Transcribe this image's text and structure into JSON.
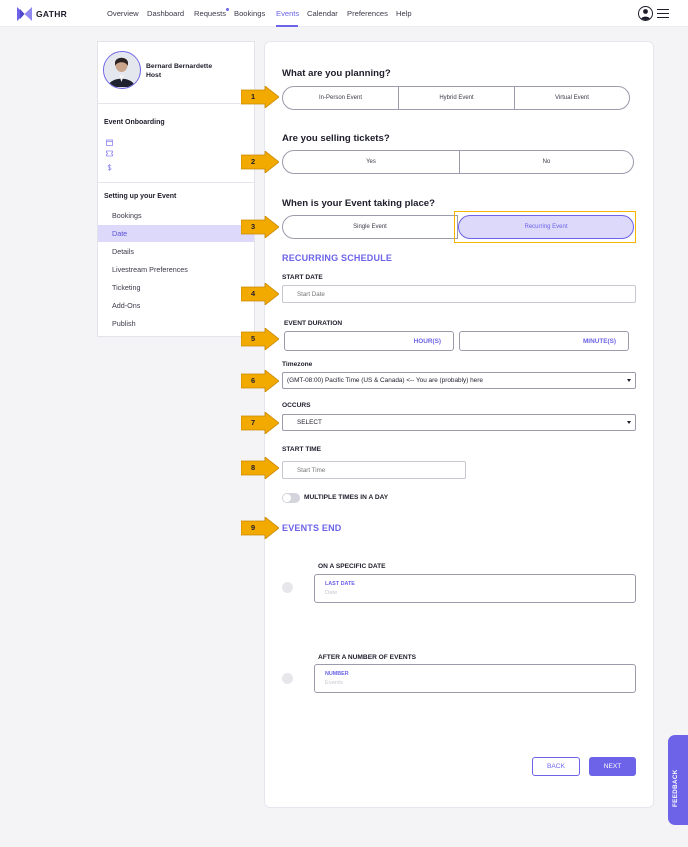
{
  "app": {
    "brand": "GATHR"
  },
  "colors": {
    "accent": "#6c63e8",
    "accent_light": "#dcd9fb",
    "highlight": "#f2b500",
    "arrow": "#f2a900"
  },
  "nav": {
    "items": [
      {
        "label": "Overview"
      },
      {
        "label": "Dashboard"
      },
      {
        "label": "Requests"
      },
      {
        "label": "Bookings"
      },
      {
        "label": "Events",
        "active": true
      },
      {
        "label": "Calendar"
      },
      {
        "label": "Preferences"
      },
      {
        "label": "Help"
      }
    ],
    "icons": {
      "avatar": "user-avatar-icon",
      "menu": "hamburger-menu-icon"
    }
  },
  "sidebar": {
    "profile": {
      "name": "Bernard Bernardette",
      "role": "Host"
    },
    "onboarding": {
      "heading": "Event Onboarding",
      "icons": [
        "calendar-icon",
        "ticket-icon",
        "dollar-icon"
      ]
    },
    "setup": {
      "heading": "Setting up your Event",
      "items": [
        {
          "label": "Bookings"
        },
        {
          "label": "Date",
          "active": true
        },
        {
          "label": "Details"
        },
        {
          "label": "Livestream Preferences"
        },
        {
          "label": "Ticketing"
        },
        {
          "label": "Add-Ons"
        },
        {
          "label": "Publish"
        }
      ]
    }
  },
  "form": {
    "planning": {
      "question": "What are you planning?",
      "options": [
        "In-Person Event",
        "Hybrid Event",
        "Virtual Event"
      ]
    },
    "tickets": {
      "question": "Are you selling tickets?",
      "options": [
        "Yes",
        "No"
      ]
    },
    "when": {
      "question": "When is your Event taking place?",
      "options": [
        "Single Event",
        "Recurring Event"
      ],
      "selected": "Recurring Event"
    },
    "recurring": {
      "title": "RECURRING SCHEDULE",
      "start_date_label": "START DATE",
      "start_date_placeholder": "Start Date",
      "duration_label": "EVENT DURATION",
      "hours_unit": "HOUR(S)",
      "minutes_unit": "MINUTE(S)",
      "timezone_label": "Timezone",
      "timezone_value": "(GMT-08:00) Pacific Time (US & Canada) <-- You are (probably) here",
      "occurs_label": "OCCURS",
      "occurs_value": "SELECT",
      "start_time_label": "START TIME",
      "start_time_placeholder": "Start Time",
      "multiple_times_label": "MULTIPLE TIMES IN A DAY",
      "multiple_times_on": false
    },
    "ends": {
      "title": "EVENTS END",
      "specific_date_label": "ON A SPECIFIC DATE",
      "last_date_label": "LAST DATE",
      "last_date_placeholder": "Date",
      "after_number_label": "AFTER A NUMBER OF EVENTS",
      "number_label": "NUMBER",
      "number_placeholder": "Events"
    },
    "buttons": {
      "back": "BACK",
      "next": "NEXT"
    }
  },
  "feedback": {
    "label": "FEEDBACK"
  },
  "steps": [
    "1",
    "2",
    "3",
    "4",
    "5",
    "6",
    "7",
    "8",
    "9"
  ]
}
